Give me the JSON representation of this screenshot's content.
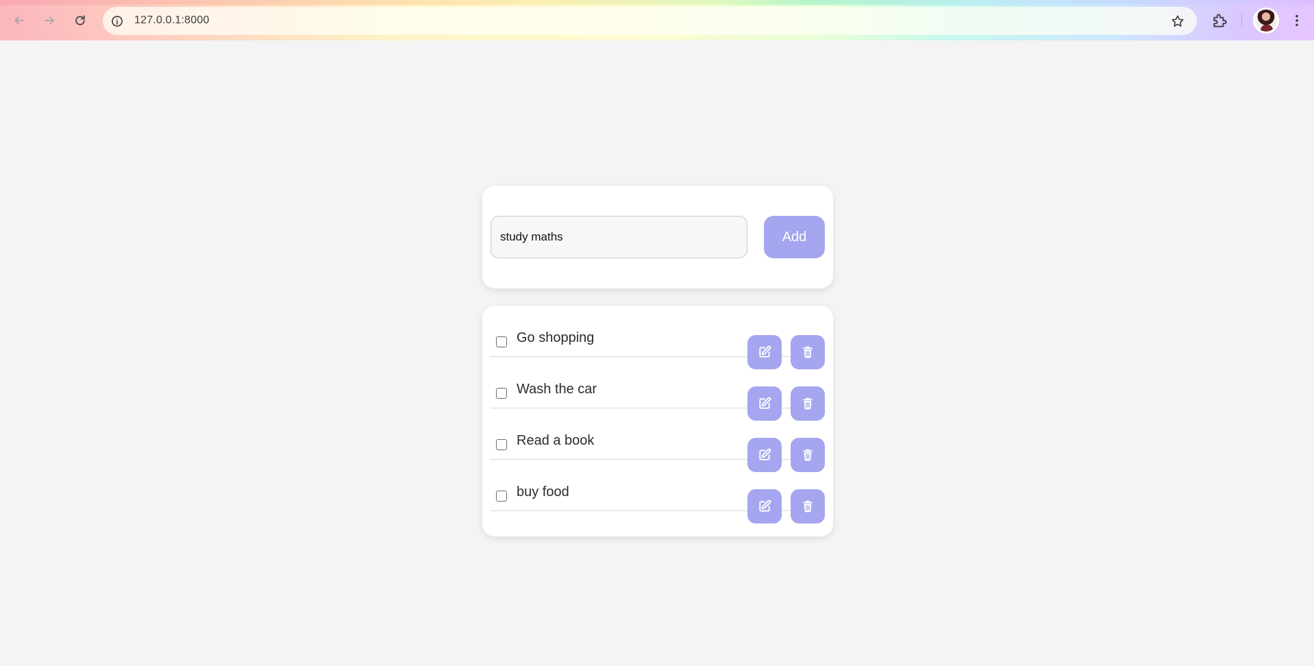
{
  "browser": {
    "url": "127.0.0.1:8000",
    "icons": {
      "back": "arrow-left-icon",
      "forward": "arrow-right-icon",
      "reload": "reload-icon",
      "site_info": "info-icon",
      "bookmark": "star-icon",
      "extensions": "puzzle-icon",
      "profile": "avatar",
      "menu": "more-vertical-icon"
    }
  },
  "app": {
    "input": {
      "value": "study maths"
    },
    "add_label": "Add",
    "accent_color": "#a5a6ef",
    "todos": [
      {
        "label": "Go shopping",
        "done": false
      },
      {
        "label": "Wash the car",
        "done": false
      },
      {
        "label": "Read a book",
        "done": false
      },
      {
        "label": "buy food",
        "done": false
      }
    ],
    "row_icons": {
      "edit": "edit-icon",
      "delete": "trash-icon"
    }
  }
}
